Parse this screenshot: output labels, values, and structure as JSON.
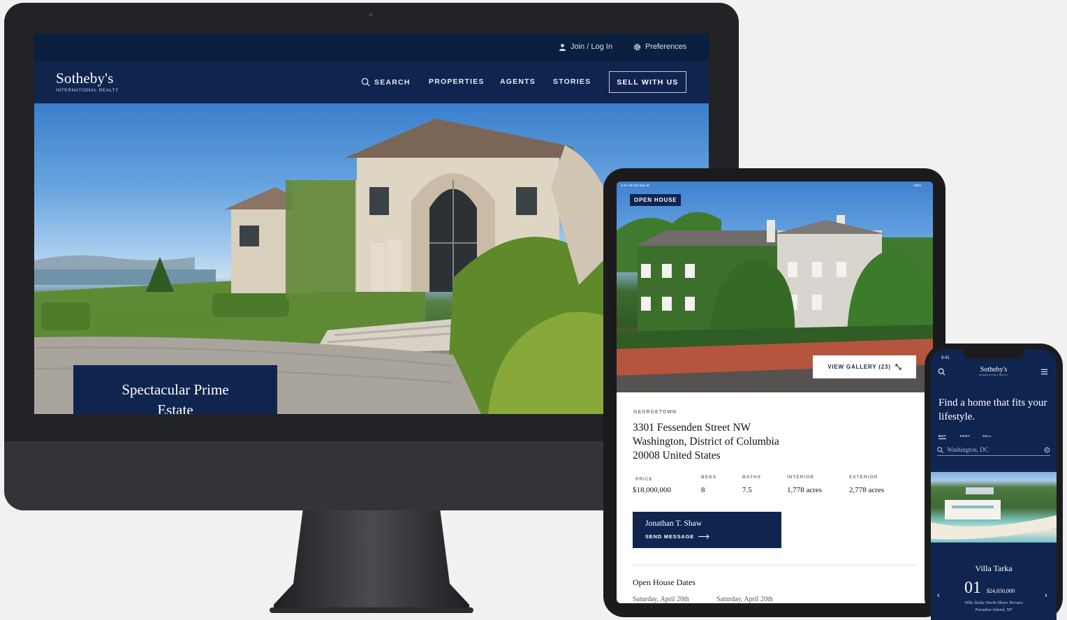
{
  "desktop": {
    "utility": {
      "login": "Join / Log In",
      "preferences": "Preferences"
    },
    "logo": {
      "name": "Sotheby's",
      "tagline": "INTERNATIONAL REALTY"
    },
    "nav": {
      "search": "SEARCH",
      "properties": "PROPERTIES",
      "agents": "AGENTS",
      "stories": "STORIES",
      "sell": "SELL WITH US"
    },
    "hero": {
      "caption_line1": "Spectacular Prime",
      "caption_line2": "Estate"
    }
  },
  "tablet": {
    "status_time": "9:41 AM  Tue Sep 10",
    "status_battery": "100%",
    "badge": "OPEN HOUSE",
    "gallery": "VIEW GALLERY (23)",
    "neighborhood": "GEORGETOWN",
    "address": [
      "3301 Fessenden Street NW",
      "Washington, District of Columbia",
      "20008 United States"
    ],
    "stats": [
      {
        "label": "PRICE",
        "value": "$18,000,000"
      },
      {
        "label": "BEDS",
        "value": "8"
      },
      {
        "label": "BATHS",
        "value": "7.5"
      },
      {
        "label": "INTERIOR",
        "value": "1,778 acres"
      },
      {
        "label": "EXTERIOR",
        "value": "2,778 acres"
      }
    ],
    "agent": {
      "name": "Jonathan T. Shaw",
      "action": "SEND MESSAGE"
    },
    "open_house_title": "Open House Dates",
    "open_house_dates": [
      "Saturday, April 20th",
      "Saturday, April 20th"
    ]
  },
  "phone": {
    "time": "9:41",
    "logo": {
      "name": "Sotheby's",
      "tagline": "INTERNATIONAL REALTY"
    },
    "headline": "Find a home that fits your lifestyle.",
    "tabs": [
      "BUY",
      "RENT",
      "SELL"
    ],
    "search_placeholder": "Washington, DC",
    "listing": {
      "title": "Villa Tarka",
      "index": "01",
      "price": "$24,650,000",
      "address_line1": "Villa Tarka North Shore Terrace",
      "address_line2": "Paradise Island, NP"
    }
  },
  "colors": {
    "navy": "#0f2550",
    "navy_dark": "#0b1f3f",
    "white": "#ffffff"
  }
}
